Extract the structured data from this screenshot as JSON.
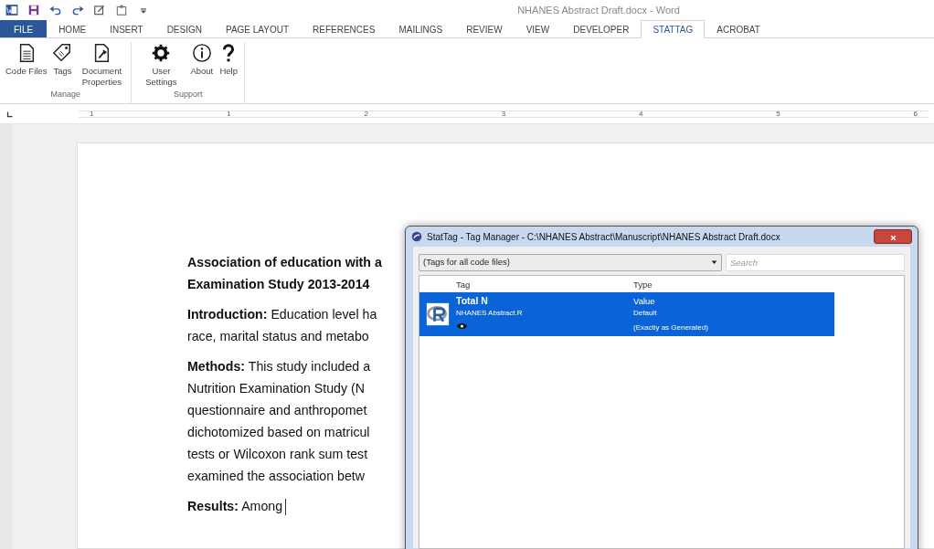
{
  "window": {
    "title": "NHANES Abstract Draft.docx - Word"
  },
  "tabs": [
    {
      "label": "FILE",
      "kind": "file",
      "selected": false
    },
    {
      "label": "HOME",
      "kind": "tab",
      "selected": false
    },
    {
      "label": "INSERT",
      "kind": "tab",
      "selected": false
    },
    {
      "label": "DESIGN",
      "kind": "tab",
      "selected": false
    },
    {
      "label": "PAGE LAYOUT",
      "kind": "tab",
      "selected": false
    },
    {
      "label": "REFERENCES",
      "kind": "tab",
      "selected": false
    },
    {
      "label": "MAILINGS",
      "kind": "tab",
      "selected": false
    },
    {
      "label": "REVIEW",
      "kind": "tab",
      "selected": false
    },
    {
      "label": "VIEW",
      "kind": "tab",
      "selected": false
    },
    {
      "label": "DEVELOPER",
      "kind": "tab",
      "selected": false
    },
    {
      "label": "STATTAG",
      "kind": "tab",
      "selected": true
    },
    {
      "label": "ACROBAT",
      "kind": "tab",
      "selected": false
    }
  ],
  "ribbon_groups": [
    {
      "label": "Manage",
      "buttons": [
        {
          "label": "Code Files",
          "kind": "file"
        },
        {
          "label": "Tags",
          "kind": "tag"
        },
        {
          "label": "Document Properties",
          "kind": "doc"
        }
      ]
    },
    {
      "label": "Support",
      "buttons": [
        {
          "label": "User Settings",
          "kind": "gear"
        },
        {
          "label": "About",
          "kind": "info"
        },
        {
          "label": "Help",
          "kind": "help"
        }
      ]
    }
  ],
  "ruler": {
    "numbers": [
      "1",
      "1",
      "2",
      "3",
      "4",
      "5",
      "6"
    ]
  },
  "document": {
    "paragraphs": [
      {
        "lines": [
          "**Association of education with a**",
          "**Examination Study 2013-2014**"
        ]
      },
      {
        "lines": [
          "**Introduction:** Education level ha",
          "race, marital status and metabo"
        ]
      },
      {
        "lines": [
          "**Methods:** This study included a",
          "Nutrition Examination Study (N",
          "questionnaire and anthropomet",
          "dichotomized based on matricul",
          "tests or Wilcoxon rank sum test",
          "examined the association betw"
        ]
      },
      {
        "lines": [
          "**Results:** Among"
        ]
      }
    ]
  },
  "dialog": {
    "title": "StatTag - Tag Manager - C:\\NHANES Abstract\\Manuscript\\NHANES Abstract Draft.docx",
    "filter": "(Tags for all code files)",
    "search": {
      "placeholder": "Search"
    },
    "columns": [
      "Tag",
      "Type"
    ],
    "rows": [
      {
        "name": "Total N",
        "file": "NHANES Abstract.R",
        "type": "Value",
        "format": "Default",
        "detail": "(Exactly as Generated)",
        "selected": true
      }
    ]
  }
}
